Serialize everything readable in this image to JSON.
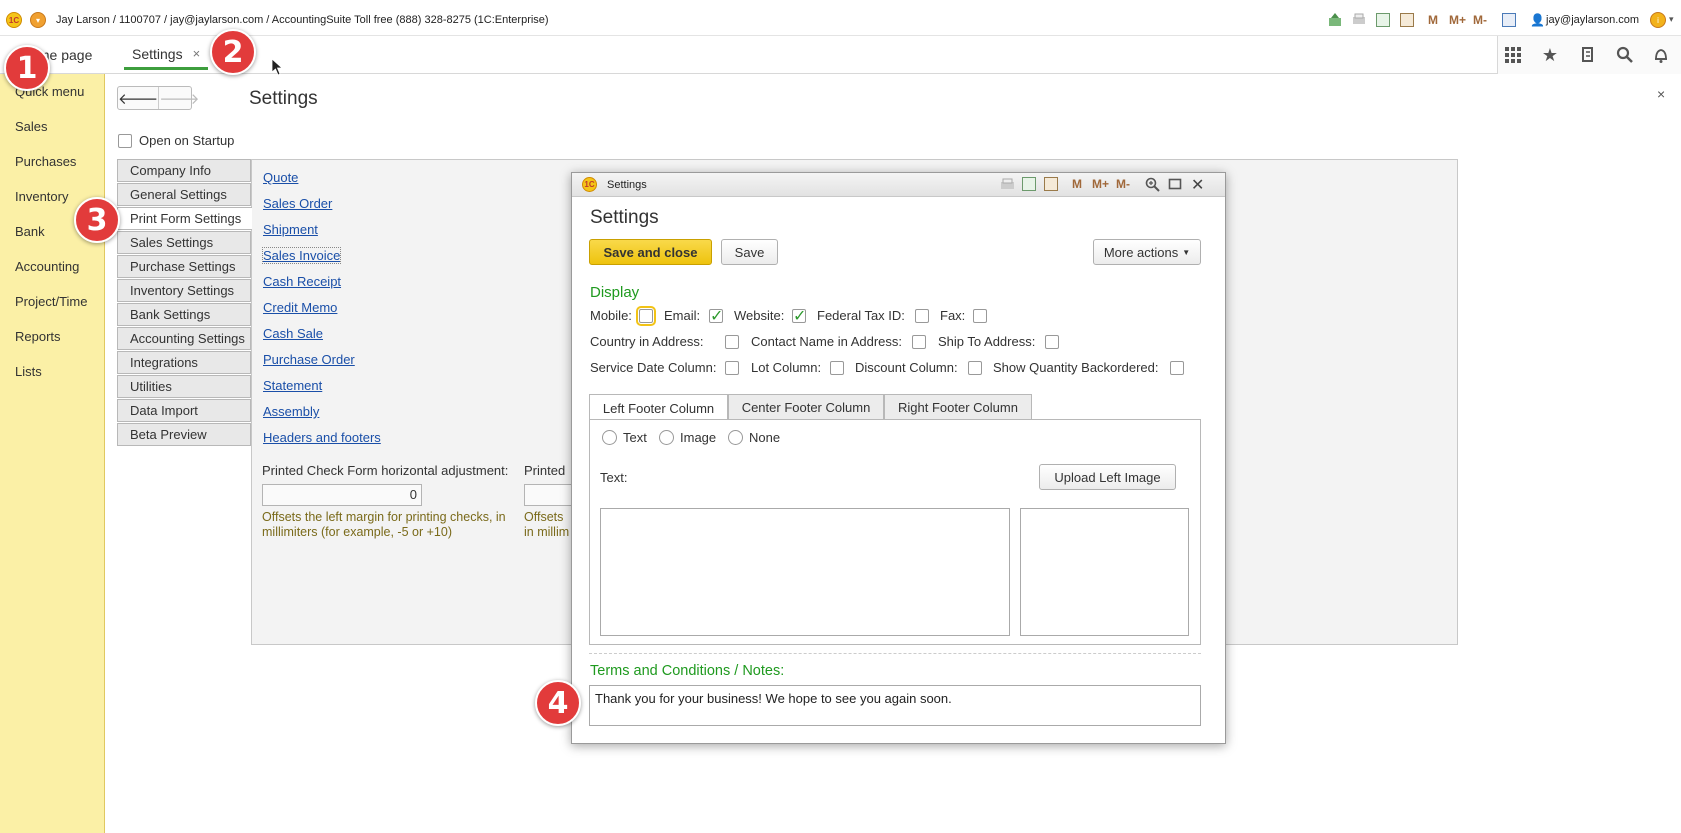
{
  "titlebar": {
    "logo": "1C",
    "text": "Jay Larson / 1100707 / jay@jaylarson.com / AccountingSuite Toll free (888) 328-8275   (1C:Enterprise)",
    "memory_buttons": [
      "M",
      "M+",
      "M-"
    ],
    "user": "jay@jaylarson.com",
    "info_icon": "i"
  },
  "tabs": {
    "home": "Home page",
    "settings": "Settings",
    "close": "×"
  },
  "sidebar": {
    "items": [
      "Quick menu",
      "Sales",
      "Purchases",
      "Inventory",
      "Bank",
      "Accounting",
      "Project/Time",
      "Reports",
      "Lists"
    ]
  },
  "page": {
    "back": "🡐",
    "forward": "🡒",
    "title": "Settings",
    "close": "×",
    "open_on_startup": "Open on Startup"
  },
  "vertical_tabs": [
    "Company Info",
    "General Settings",
    "Print Form Settings",
    "Sales Settings",
    "Purchase Settings",
    "Inventory Settings",
    "Bank Settings",
    "Accounting Settings",
    "Integrations",
    "Utilities",
    "Data Import",
    "Beta Preview"
  ],
  "active_vertical_tab": "Print Form Settings",
  "form_links": [
    "Quote",
    "Sales Order",
    "Shipment",
    "Sales Invoice",
    "Cash Receipt",
    "Credit Memo",
    "Cash Sale",
    "Purchase Order",
    "Statement",
    "Assembly",
    "Headers and footers"
  ],
  "adjustment": {
    "label": "Printed Check Form horizontal adjustment:",
    "label_cut": "Printed",
    "value": "0",
    "hint": "Offsets the left margin for printing checks, in millimiters (for example, -5 or +10)",
    "hint_cut": "Offsets in millim"
  },
  "modal": {
    "window_title": "Settings",
    "heading": "Settings",
    "memory_buttons": [
      "M",
      "M+",
      "M-"
    ],
    "save_and_close": "Save and close",
    "save": "Save",
    "more_actions": "More actions",
    "display": {
      "title": "Display",
      "row1": [
        {
          "label": "Mobile:",
          "checked": false
        },
        {
          "label": "Email:",
          "checked": true
        },
        {
          "label": "Website:",
          "checked": true
        },
        {
          "label": "Federal Tax ID:",
          "checked": false
        },
        {
          "label": "Fax:",
          "checked": false
        }
      ],
      "row2": [
        {
          "label": "Country in Address:",
          "checked": false
        },
        {
          "label": "Contact Name in Address:",
          "checked": false
        },
        {
          "label": "Ship To Address:",
          "checked": false
        }
      ],
      "row3": [
        {
          "label": "Service Date Column:",
          "checked": false
        },
        {
          "label": "Lot Column:",
          "checked": false
        },
        {
          "label": "Discount Column:",
          "checked": false
        },
        {
          "label": "Show Quantity Backordered:",
          "checked": false
        }
      ]
    },
    "footer_tabs": [
      "Left Footer Column",
      "Center Footer Column",
      "Right Footer Column"
    ],
    "footer_radio": [
      "Text",
      "Image",
      "None"
    ],
    "text_label": "Text:",
    "upload_button": "Upload Left Image",
    "terms_title": "Terms and Conditions / Notes:",
    "terms_value": "Thank you for your business!  We hope to see you again soon."
  },
  "markers": [
    "1",
    "2",
    "3",
    "4"
  ],
  "colors": {
    "sidebar_bg": "#fbf0a6",
    "accent_green": "#1f9a1f",
    "primary_button": "#f2c316",
    "marker_red": "#e23b3b",
    "link_blue": "#1a4fa8"
  }
}
